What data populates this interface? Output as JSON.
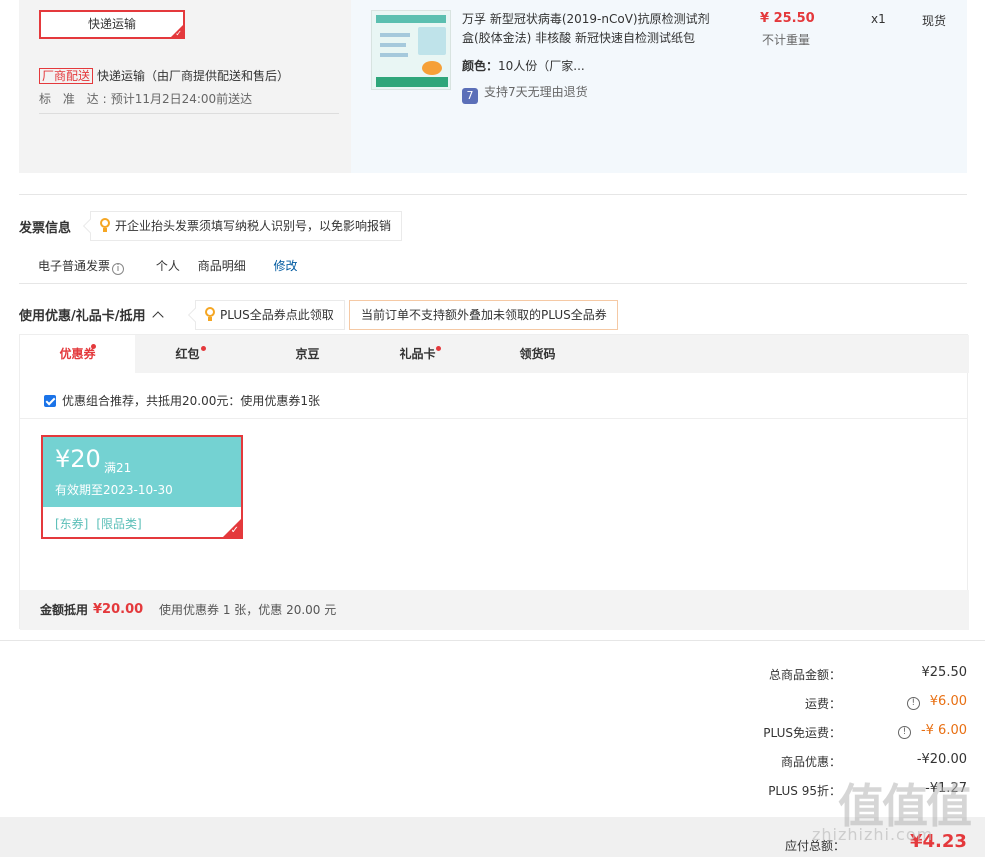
{
  "shipping": {
    "method_button": "快递运输",
    "vendor_tag": "厂商配送",
    "method_desc": "快递运输（由厂商提供配送和售后）",
    "standard_label": "标 准 达:",
    "standard_value": "预计11月2日24:00前送达"
  },
  "product": {
    "title": "万孚 新型冠状病毒(2019-nCoV)抗原检测试剂盒(胶体金法) 非核酸 新冠快速自检测试纸包",
    "color_label": "颜色：",
    "color_value": "10人份（厂家...",
    "return_icon": "7",
    "return_text": "支持7天无理由退货",
    "price": "¥ 25.50",
    "weight": "不计重量",
    "qty": "x1",
    "stock": "现货"
  },
  "invoice": {
    "title": "发票信息",
    "tip": "开企业抬头发票须填写纳税人识别号，以免影响报销",
    "type": "电子普通发票",
    "type_info_icon": "i",
    "holder": "个人",
    "content": "商品明细",
    "edit": "修改"
  },
  "coupons": {
    "title": "使用优惠/礼品卡/抵用",
    "plus_tip": "PLUS全品券点此领取",
    "plus_warn": "当前订单不支持额外叠加未领取的PLUS全品券",
    "tabs": [
      {
        "label": "优惠券",
        "dot": true
      },
      {
        "label": "红包",
        "dot": true
      },
      {
        "label": "京豆",
        "dot": false
      },
      {
        "label": "礼品卡",
        "dot": true
      },
      {
        "label": "领货码",
        "dot": false
      }
    ],
    "combo_text": "优惠组合推荐，共抵用20.00元：使用优惠券1张",
    "coupon": {
      "amount": "¥20",
      "condition": "满21",
      "valid": "有效期至2023-10-30",
      "tag1": "[东券]",
      "tag2": "[限品类]"
    },
    "summary_label": "金额抵用",
    "summary_amount": "¥20.00",
    "summary_desc": "使用优惠券 1 张，优惠 20.00 元"
  },
  "totals": {
    "rows": [
      {
        "label": "总商品金额：",
        "value": "¥25.50"
      },
      {
        "label": "运费：",
        "value": "¥6.00"
      },
      {
        "label": "PLUS免运费：",
        "value": "-¥ 6.00"
      },
      {
        "label": "商品优惠：",
        "value": "-¥20.00"
      },
      {
        "label": "PLUS 95折：",
        "value": "-¥1.27"
      }
    ],
    "pay_label": "应付总额：",
    "pay_amount": "¥4.23"
  },
  "watermark": {
    "glyphs": "值值值",
    "site": "zhizhizhi.com"
  },
  "colors": {
    "accent": "#e4393c",
    "coupon_teal": "#74d2d2",
    "orange": "#e86f12",
    "link": "#005aa0"
  }
}
